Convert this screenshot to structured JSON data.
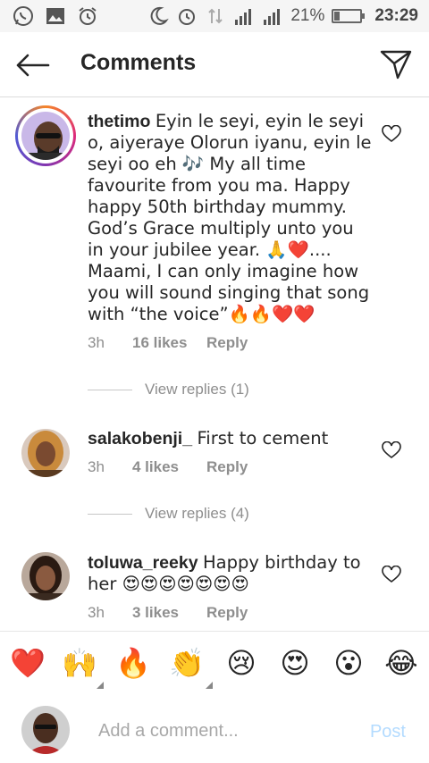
{
  "status_bar": {
    "battery": "21%",
    "battery_level": 0.21,
    "time": "23:29",
    "icons": [
      "whatsapp-icon",
      "gallery-icon",
      "alarm-icon",
      "moon-icon",
      "alarm-icon",
      "data-icon",
      "signal-icon",
      "signal-icon",
      "battery-icon"
    ]
  },
  "header": {
    "title": "Comments",
    "back_icon": "back-arrow-icon",
    "send_icon": "send-icon"
  },
  "comments": [
    {
      "username": "thetimo",
      "text": "Eyin le seyi, eyin le seyi o, aiyeraye Olorun iyanu, eyin le seyi oo eh 🎶 My all time favourite from you ma. Happy happy 50th birthday mummy. God’s Grace multiply unto you in your jubilee year. 🙏❤️.... Maami, I can only imagine how you will sound singing that song with “the voice”🔥🔥❤️❤️",
      "time": "3h",
      "likes": "16 likes",
      "reply": "Reply",
      "view_replies": "View replies (1)"
    },
    {
      "username": "salakobenji_",
      "text": "First to cement",
      "time": "3h",
      "likes": "4 likes",
      "reply": "Reply",
      "view_replies": "View replies (4)"
    },
    {
      "username": "toluwa_reeky",
      "text": "Happy birthday to her 😍😍😍😍😍😍😍",
      "time": "3h",
      "likes": "3 likes",
      "reply": "Reply"
    }
  ],
  "reactions": [
    "❤️",
    "🙌",
    "🔥",
    "👏",
    "😢",
    "😍",
    "😮",
    "😂"
  ],
  "composer": {
    "placeholder": "Add a comment...",
    "post_label": "Post"
  },
  "colors": {
    "like_outline": "#262626",
    "meta_gray": "#8e8e8e",
    "post_disabled": "#b3dbff",
    "ring_gradient": [
      "#f58529",
      "#dd2a7b",
      "#8134af",
      "#515bd4"
    ]
  }
}
